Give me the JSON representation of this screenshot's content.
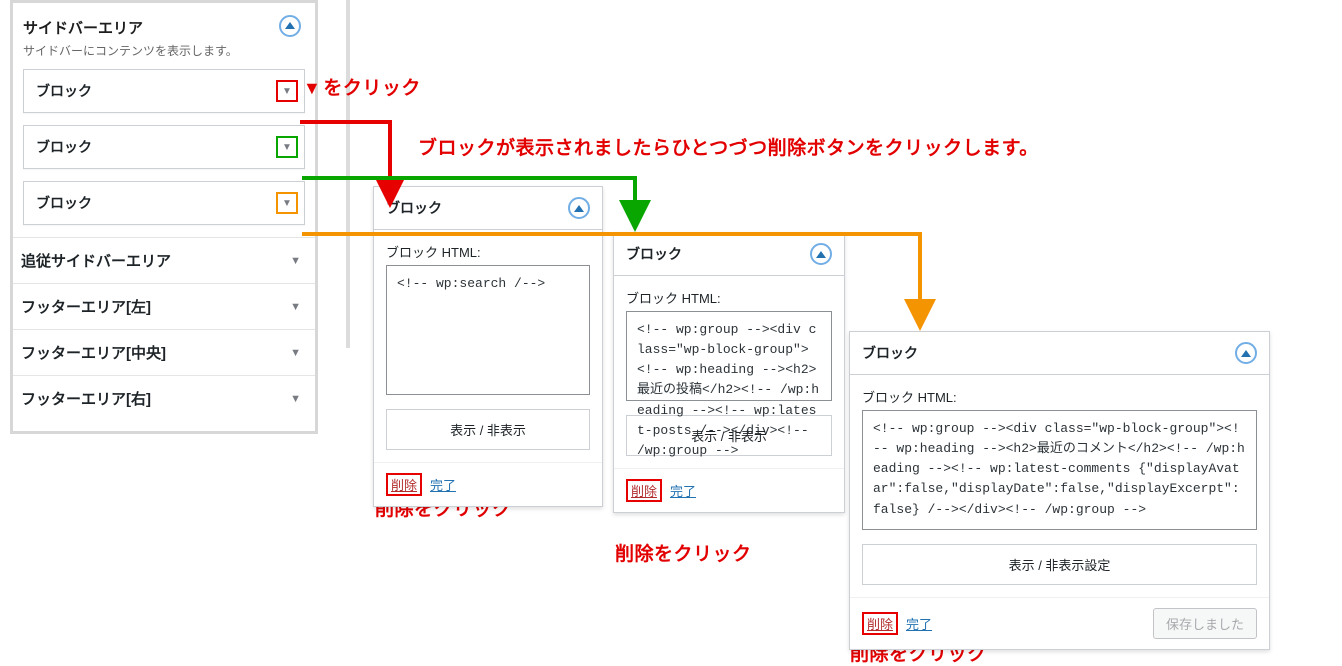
{
  "sidebar": {
    "area_title": "サイドバーエリア",
    "area_desc": "サイドバーにコンテンツを表示します。",
    "block_label": "ブロック",
    "sections": [
      "追従サイドバーエリア",
      "フッターエリア[左]",
      "フッターエリア[中央]",
      "フッターエリア[右]"
    ]
  },
  "annot": {
    "click_triangle": "をクリック",
    "instruction": "ブロックが表示されましたらひとつづつ削除ボタンをクリックします。",
    "click_delete": "削除をクリック"
  },
  "panel": {
    "title": "ブロック",
    "html_label": "ブロック HTML:",
    "visibility": "表示 / 非表示設定",
    "visibility_short": "表示 / 非表示",
    "delete": "削除",
    "done": "完了",
    "saved": "保存しました"
  },
  "codes": {
    "p1": "<!-- wp:search /-->",
    "p2": "<!-- wp:group --><div class=\"wp-block-group\"><!-- wp:heading --><h2>最近の投稿</h2><!-- /wp:heading --><!-- wp:latest-posts /--></div><!-- /wp:group -->",
    "p3": "<!-- wp:group --><div class=\"wp-block-group\"><!-- wp:heading --><h2>最近のコメント</h2><!-- /wp:heading --><!-- wp:latest-comments {\"displayAvatar\":false,\"displayDate\":false,\"displayExcerpt\":false} /--></div><!-- /wp:group -->"
  }
}
